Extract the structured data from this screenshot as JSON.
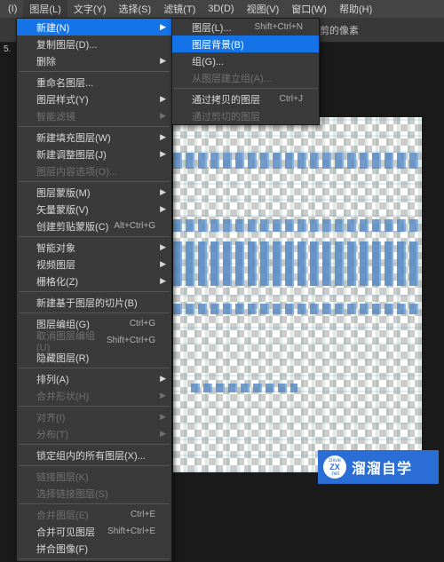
{
  "menubar": [
    {
      "label": "(I)"
    },
    {
      "label": "图层(L)"
    },
    {
      "label": "文字(Y)"
    },
    {
      "label": "选择(S)"
    },
    {
      "label": "滤镜(T)"
    },
    {
      "label": "3D(D)"
    },
    {
      "label": "视图(V)"
    },
    {
      "label": "窗口(W)"
    },
    {
      "label": "帮助(H)"
    }
  ],
  "toolbar": {
    "note": "剪的像素"
  },
  "sidebar": {
    "tab": "5."
  },
  "mainMenu": [
    {
      "label": "新建(N)",
      "arrow": true,
      "hl": true
    },
    {
      "label": "复制图层(D)..."
    },
    {
      "label": "删除",
      "arrow": true
    },
    {
      "sep": true
    },
    {
      "label": "重命名图层..."
    },
    {
      "label": "图层样式(Y)",
      "arrow": true
    },
    {
      "label": "智能滤镜",
      "arrow": true,
      "disabled": true
    },
    {
      "sep": true
    },
    {
      "label": "新建填充图层(W)",
      "arrow": true
    },
    {
      "label": "新建调整图层(J)",
      "arrow": true
    },
    {
      "label": "图层内容选项(O)...",
      "disabled": true
    },
    {
      "sep": true
    },
    {
      "label": "图层蒙版(M)",
      "arrow": true
    },
    {
      "label": "矢量蒙版(V)",
      "arrow": true
    },
    {
      "label": "创建剪贴蒙版(C)",
      "shortcut": "Alt+Ctrl+G"
    },
    {
      "sep": true
    },
    {
      "label": "智能对象",
      "arrow": true
    },
    {
      "label": "视频图层",
      "arrow": true
    },
    {
      "label": "栅格化(Z)",
      "arrow": true
    },
    {
      "sep": true
    },
    {
      "label": "新建基于图层的切片(B)"
    },
    {
      "sep": true
    },
    {
      "label": "图层编组(G)",
      "shortcut": "Ctrl+G"
    },
    {
      "label": "取消图层编组(U)",
      "shortcut": "Shift+Ctrl+G",
      "disabled": true
    },
    {
      "label": "隐藏图层(R)"
    },
    {
      "sep": true
    },
    {
      "label": "排列(A)",
      "arrow": true
    },
    {
      "label": "合并形状(H)",
      "arrow": true,
      "disabled": true
    },
    {
      "sep": true
    },
    {
      "label": "对齐(I)",
      "arrow": true,
      "disabled": true
    },
    {
      "label": "分布(T)",
      "arrow": true,
      "disabled": true
    },
    {
      "sep": true
    },
    {
      "label": "锁定组内的所有图层(X)..."
    },
    {
      "sep": true
    },
    {
      "label": "链接图层(K)",
      "disabled": true
    },
    {
      "label": "选择链接图层(S)",
      "disabled": true
    },
    {
      "sep": true
    },
    {
      "label": "合并图层(E)",
      "shortcut": "Ctrl+E",
      "disabled": true
    },
    {
      "label": "合并可见图层",
      "shortcut": "Shift+Ctrl+E"
    },
    {
      "label": "拼合图像(F)"
    },
    {
      "sep": true
    }
  ],
  "submenu": [
    {
      "label": "图层(L)...",
      "shortcut": "Shift+Ctrl+N"
    },
    {
      "label": "图层背景(B)",
      "hl": true
    },
    {
      "label": "组(G)..."
    },
    {
      "label": "从图层建立组(A)...",
      "disabled": true
    },
    {
      "sep": true
    },
    {
      "label": "通过拷贝的图层",
      "shortcut": "Ctrl+J"
    },
    {
      "label": "通过剪切的图层",
      "disabled": true
    }
  ],
  "watermark": {
    "brandTop": "zixue",
    "brandBig": "ZX",
    "site": ".net",
    "text": "溜溜自学"
  }
}
